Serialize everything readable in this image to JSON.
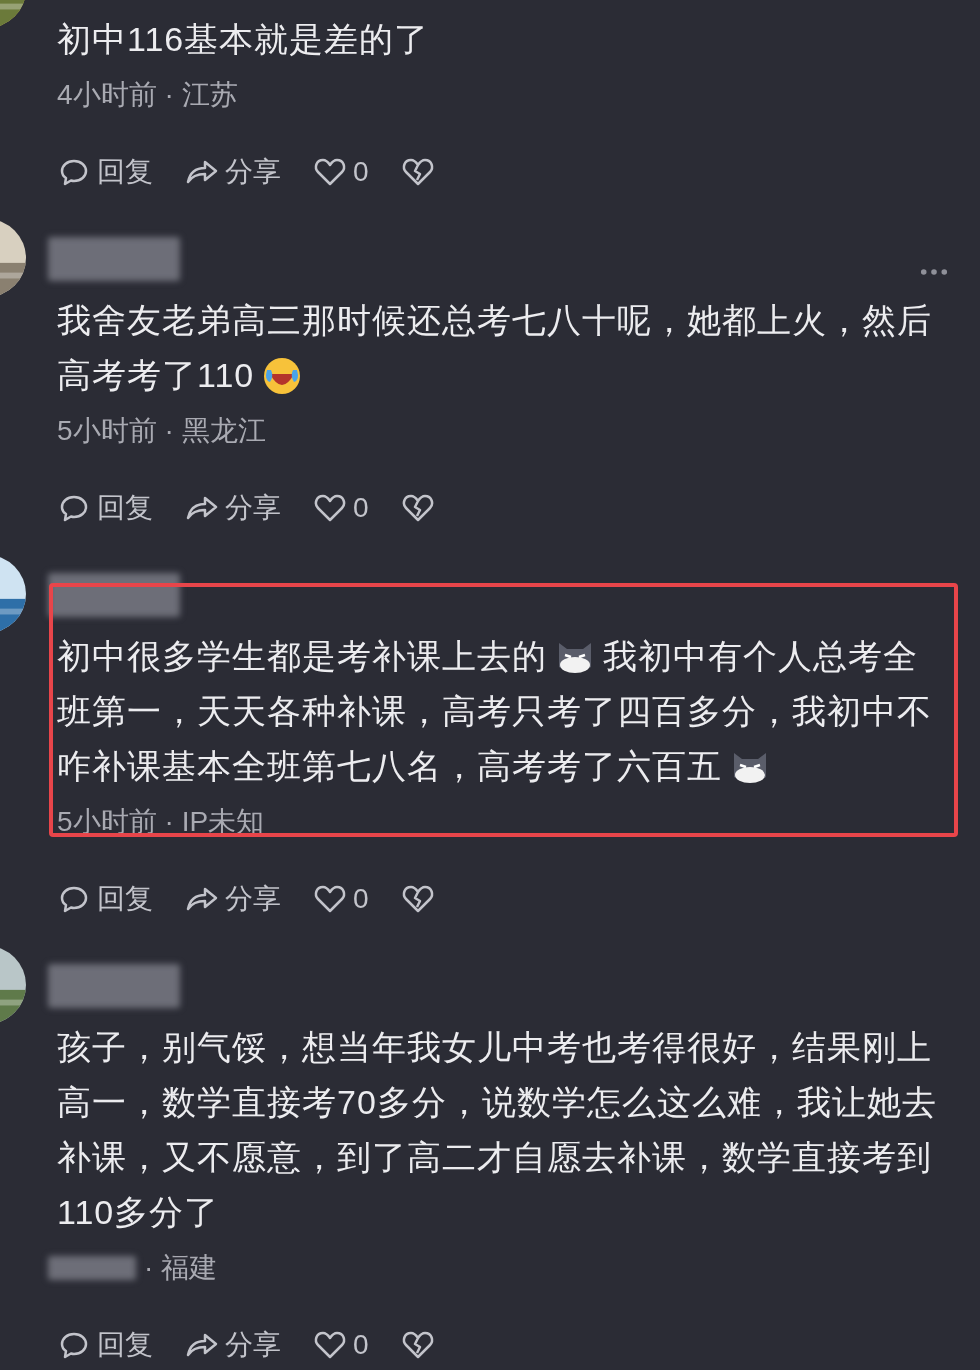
{
  "comments": [
    {
      "username_blurred": false,
      "more_menu": false,
      "highlighted": false,
      "lines": [
        [
          {
            "kind": "text",
            "text": "初中116基本就是差的了"
          }
        ]
      ],
      "meta": {
        "time_blurred": false,
        "time": "4小时前",
        "region": "· 江苏"
      },
      "actions": {
        "reply": "回复",
        "share": "分享",
        "likes": "0"
      }
    },
    {
      "username_blurred": true,
      "more_menu": true,
      "highlighted": false,
      "lines": [
        [
          {
            "kind": "text",
            "text": "我舍友老弟高三那时候还总考七八十呢，她都上火，然后"
          }
        ],
        [
          {
            "kind": "text",
            "text": "高考考了110"
          },
          {
            "kind": "laughing"
          }
        ]
      ],
      "meta": {
        "time_blurred": false,
        "time": "5小时前",
        "region": "· 黑龙江"
      },
      "actions": {
        "reply": "回复",
        "share": "分享",
        "likes": "0"
      }
    },
    {
      "username_blurred": true,
      "more_menu": false,
      "highlighted": true,
      "lines": [
        [
          {
            "kind": "text",
            "text": "初中很多学生都是考补课上去的"
          },
          {
            "kind": "cat"
          },
          {
            "kind": "text",
            "text": "我初中有个人总考全"
          }
        ],
        [
          {
            "kind": "text",
            "text": "班第一，天天各种补课，高考只考了四百多分，我初中不"
          }
        ],
        [
          {
            "kind": "text",
            "text": "咋补课基本全班第七八名，高考考了六百五"
          },
          {
            "kind": "cat"
          }
        ]
      ],
      "meta": {
        "time_blurred": false,
        "time": "5小时前",
        "region": "· IP未知"
      },
      "actions": {
        "reply": "回复",
        "share": "分享",
        "likes": "0"
      }
    },
    {
      "username_blurred": true,
      "more_menu": false,
      "highlighted": false,
      "lines": [
        [
          {
            "kind": "text",
            "text": "孩子，别气馁，想当年我女儿中考也考得很好，结果刚上"
          }
        ],
        [
          {
            "kind": "text",
            "text": "高一，数学直接考70多分，说数学怎么这么难，我让她去"
          }
        ],
        [
          {
            "kind": "text",
            "text": "补课，又不愿意，到了高二才自愿去补课，数学直接考到"
          }
        ],
        [
          {
            "kind": "text",
            "text": "110多分了"
          }
        ]
      ],
      "meta": {
        "time_blurred": true,
        "region": "· 福建"
      },
      "actions": {
        "reply": "回复",
        "share": "分享",
        "likes": "0"
      }
    }
  ]
}
